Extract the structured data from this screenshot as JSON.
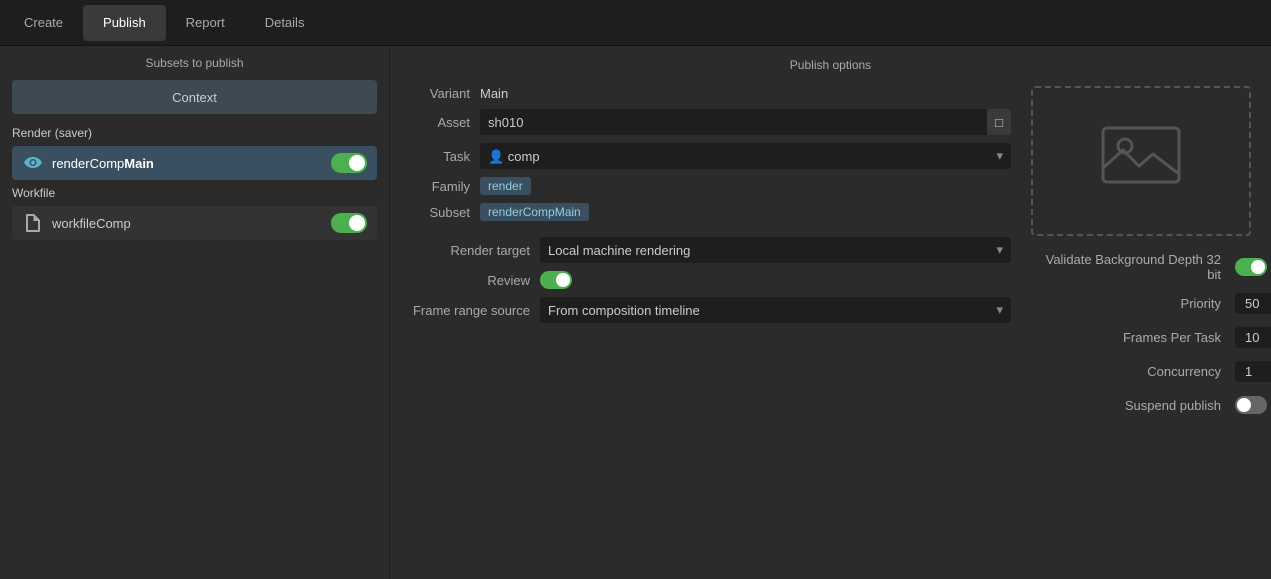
{
  "nav": {
    "tabs": [
      {
        "id": "create",
        "label": "Create",
        "active": false
      },
      {
        "id": "publish",
        "label": "Publish",
        "active": true
      },
      {
        "id": "report",
        "label": "Report",
        "active": false
      },
      {
        "id": "details",
        "label": "Details",
        "active": false
      }
    ]
  },
  "left_panel": {
    "title": "Subsets to publish",
    "context_button": "Context",
    "render_section_label": "Render (saver)",
    "subsets": [
      {
        "id": "renderCompMain",
        "label_prefix": "renderComp",
        "label_bold": "Main",
        "icon": "eye",
        "enabled": true
      }
    ],
    "workfile_section_label": "Workfile",
    "workfiles": [
      {
        "id": "workfileComp",
        "label": "workfileComp",
        "icon": "file",
        "enabled": true
      }
    ]
  },
  "right_panel": {
    "title": "Publish options",
    "form": {
      "variant_label": "Variant",
      "variant_value": "Main",
      "asset_label": "Asset",
      "asset_value": "sh010",
      "task_label": "Task",
      "task_value": "comp",
      "family_label": "Family",
      "family_value": "render",
      "subset_label": "Subset",
      "subset_value": "renderCompMain"
    },
    "options": {
      "render_target_label": "Render target",
      "render_target_value": "Local machine rendering",
      "review_label": "Review",
      "review_enabled": true,
      "frame_range_label": "Frame range source",
      "frame_range_value": "From composition timeline"
    },
    "right_options": {
      "validate_bg_depth_label": "Validate Background Depth 32 bit",
      "validate_bg_depth_enabled": true,
      "priority_label": "Priority",
      "priority_value": "50",
      "frames_per_task_label": "Frames Per Task",
      "frames_per_task_value": "10",
      "concurrency_label": "Concurrency",
      "concurrency_value": "1",
      "suspend_publish_label": "Suspend publish",
      "suspend_publish_enabled": false
    }
  }
}
